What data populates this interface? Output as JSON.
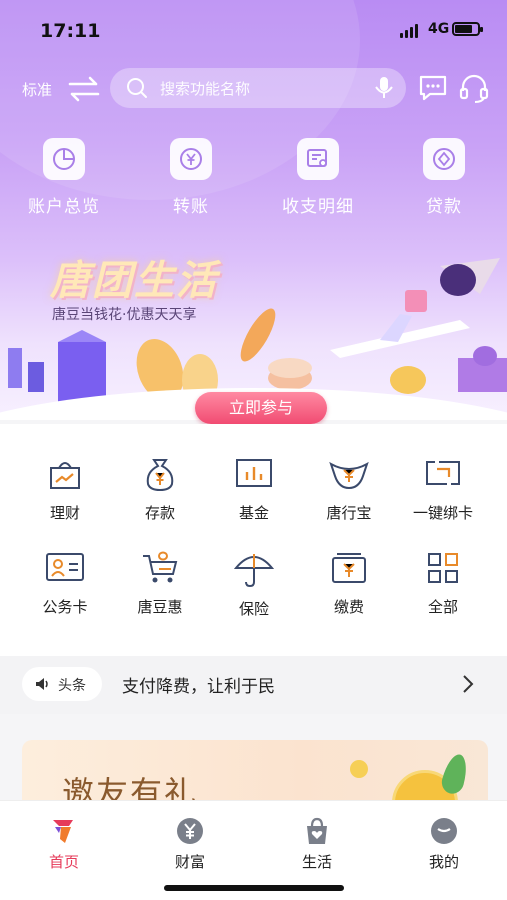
{
  "status": {
    "time": "17:11",
    "network": "4G"
  },
  "topbar": {
    "mode_label": "标准",
    "search_placeholder": "搜索功能名称"
  },
  "quick_actions": [
    {
      "label": "账户总览",
      "icon": "pie-chart-icon"
    },
    {
      "label": "转账",
      "icon": "yuan-transfer-icon"
    },
    {
      "label": "收支明细",
      "icon": "statement-search-icon"
    },
    {
      "label": "贷款",
      "icon": "loan-diamond-icon"
    }
  ],
  "banner": {
    "title": "唐团生活",
    "subtitle": "唐豆当钱花·优惠天天享",
    "cta": "立即参与"
  },
  "services": [
    {
      "label": "理财",
      "icon": "wealth-bag-icon"
    },
    {
      "label": "存款",
      "icon": "money-bag-icon"
    },
    {
      "label": "基金",
      "icon": "fund-chart-icon"
    },
    {
      "label": "唐行宝",
      "icon": "treasure-icon"
    },
    {
      "label": "一键绑卡",
      "icon": "bind-card-icon"
    },
    {
      "label": "公务卡",
      "icon": "official-card-icon"
    },
    {
      "label": "唐豆惠",
      "icon": "shopping-cart-icon"
    },
    {
      "label": "保险",
      "icon": "umbrella-icon"
    },
    {
      "label": "缴费",
      "icon": "payment-icon"
    },
    {
      "label": "全部",
      "icon": "grid-icon"
    }
  ],
  "news": {
    "tag": "头条",
    "headline": "支付降费，让利于民"
  },
  "promo": {
    "title": "邀友有礼"
  },
  "tabs": [
    {
      "label": "首页",
      "icon": "home-logo-icon",
      "active": true
    },
    {
      "label": "财富",
      "icon": "yuan-circle-icon",
      "active": false
    },
    {
      "label": "生活",
      "icon": "shopping-bag-icon",
      "active": false
    },
    {
      "label": "我的",
      "icon": "profile-icon",
      "active": false
    }
  ],
  "colors": {
    "accent": "#e63b5a",
    "hero_top": "#b98cf3",
    "icon_blue": "#3b4a6b",
    "icon_orange": "#e88a2a"
  }
}
